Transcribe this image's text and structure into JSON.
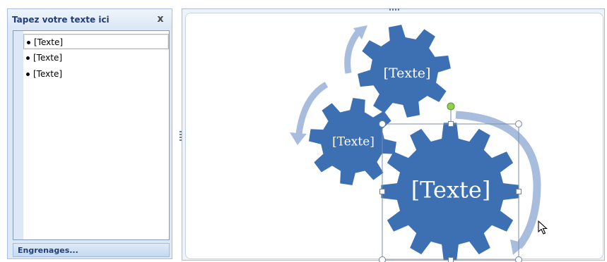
{
  "text_pane": {
    "title": "Tapez votre texte ici",
    "close_label": "x",
    "items": [
      {
        "label": "[Texte]"
      },
      {
        "label": "[Texte]"
      },
      {
        "label": "[Texte]"
      }
    ],
    "footer_link": "Engrenages..."
  },
  "diagram": {
    "gears": [
      {
        "label": "[Texte]"
      },
      {
        "label": "[Texte]"
      },
      {
        "label": "[Texte]"
      }
    ]
  },
  "colors": {
    "gear_fill": "#3d6fb3",
    "arrow": "#a8bddd",
    "pane_bg": "#dce8f5",
    "title_text": "#1f3f77",
    "rotate_handle": "#8fd14f"
  },
  "icons": [
    "close-icon",
    "bullet-icon",
    "rotate-handle-icon",
    "resize-handle-icon",
    "mouse-pointer-icon"
  ]
}
